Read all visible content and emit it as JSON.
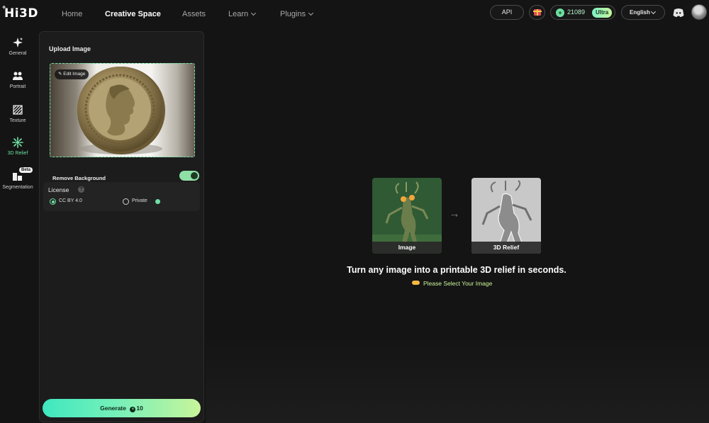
{
  "app": {
    "logo_text": "Hi3D",
    "logo_plus": "+"
  },
  "nav": {
    "items": [
      {
        "label": "Home"
      },
      {
        "label": "Creative Space"
      },
      {
        "label": "Assets"
      },
      {
        "label": "Learn"
      },
      {
        "label": "Plugins"
      }
    ]
  },
  "header": {
    "api_label": "API",
    "credits": "21089",
    "coin_symbol": "+",
    "plan_badge": "Ultra",
    "language": "English",
    "icons": [
      "gift-icon",
      "coin-icon",
      "discord-icon",
      "avatar"
    ]
  },
  "sidebar": {
    "items": [
      {
        "label": "General",
        "icon": "sparkle-icon"
      },
      {
        "label": "Portrait",
        "icon": "people-icon"
      },
      {
        "label": "Texture",
        "icon": "texture-icon"
      },
      {
        "label": "3D Relief",
        "icon": "relief-icon",
        "active": true
      },
      {
        "label": "Segmentation",
        "icon": "segmentation-icon",
        "badge": "Beta"
      }
    ]
  },
  "panel": {
    "upload_title": "Upload Image",
    "edit_image_label": "Edit Image",
    "remove_background_label": "Remove Background",
    "remove_background_on": true,
    "license_title": "License",
    "license_info": "?",
    "license_options": [
      {
        "label": "CC BY 4.0",
        "selected": true
      },
      {
        "label": "Private",
        "selected": false
      }
    ],
    "generate_label": "Generate",
    "generate_cost": "10"
  },
  "main": {
    "example_input_label": "Image",
    "example_output_label": "3D Relief",
    "arrow_text": "····›",
    "headline": "Turn any image into a printable 3D relief in seconds.",
    "hint": "Please Select Your Image"
  },
  "colors": {
    "accent": "#6ee0a2",
    "background": "#141414",
    "panel": "#1c1c1c"
  }
}
